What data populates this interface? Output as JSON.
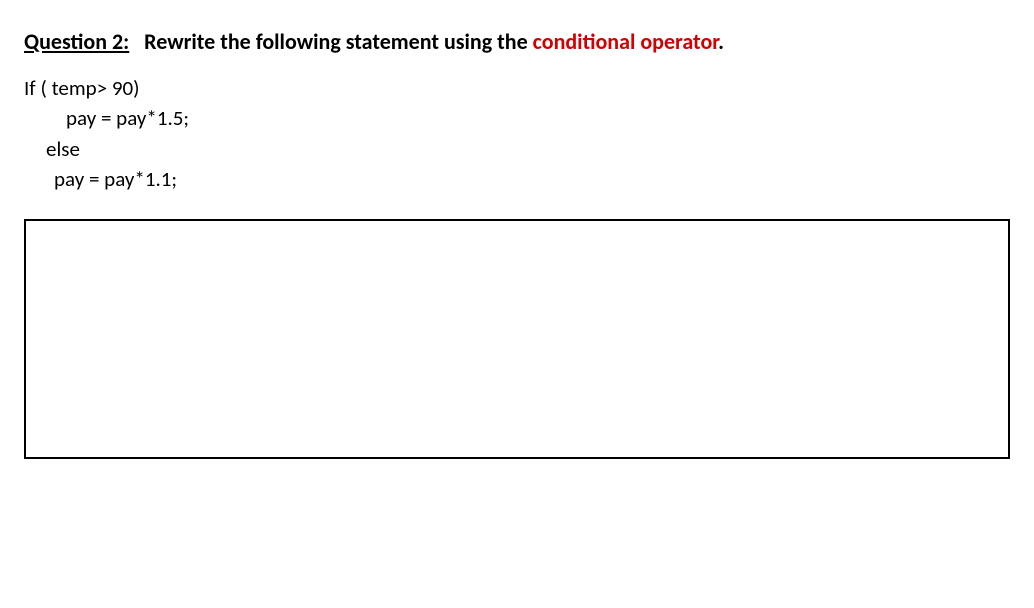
{
  "heading": {
    "label": "Question 2:",
    "prompt_part1": "Rewrite the following statement using the ",
    "highlight": "conditional operator",
    "prompt_part2": "."
  },
  "code": {
    "line1": "If ( temp>  90)",
    "line2": "pay = pay*1.5;",
    "line3": "else",
    "line4": "pay = pay*1.1;"
  }
}
